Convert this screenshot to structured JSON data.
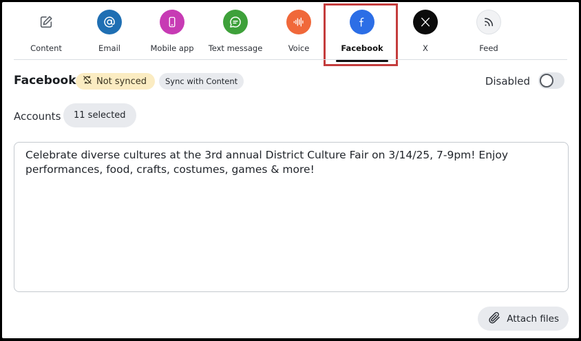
{
  "tabs": [
    {
      "label": "Content",
      "icon": "edit-icon",
      "color": "#ffffff",
      "active": false
    },
    {
      "label": "Email",
      "icon": "at-sign-icon",
      "color": "#1f6fb3",
      "active": false
    },
    {
      "label": "Mobile app",
      "icon": "mobile-phone-icon",
      "color": "#c73bb4",
      "active": false
    },
    {
      "label": "Text message",
      "icon": "chat-bubble-icon",
      "color": "#3ea13a",
      "active": false
    },
    {
      "label": "Voice",
      "icon": "sound-wave-icon",
      "color": "#f0683a",
      "active": false
    },
    {
      "label": "Facebook",
      "icon": "facebook-icon",
      "color": "#2c6ee6",
      "active": true
    },
    {
      "label": "X",
      "icon": "x-logo-icon",
      "color": "#0b0b0b",
      "active": false
    },
    {
      "label": "Feed",
      "icon": "rss-feed-icon",
      "color": "#f1f2f4",
      "active": false
    }
  ],
  "channel": {
    "title": "Facebook",
    "status": "Not synced",
    "sync_label": "Sync with Content",
    "toggle_label": "Disabled",
    "toggle_on": false
  },
  "accounts": {
    "label": "Accounts",
    "selected": "11 selected"
  },
  "message": {
    "text": "Celebrate diverse cultures at the 3rd annual District Culture Fair on 3/14/25, 7-9pm! Enjoy performances, food, crafts, costumes, games & more!"
  },
  "attach": {
    "label": "Attach files"
  },
  "colors": {
    "highlight": "#c43c3c",
    "status_badge_bg": "#fbecc2",
    "chip_bg": "#e8eaee"
  }
}
